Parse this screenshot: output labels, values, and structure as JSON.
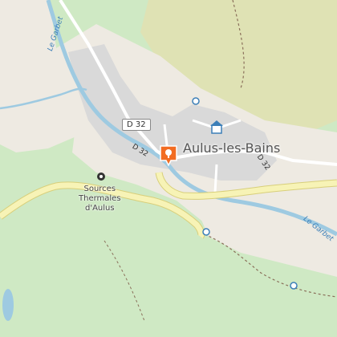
{
  "map": {
    "town_name": "Aulus-les-Bains",
    "poi_label_line1": "Sources",
    "poi_label_line2": "Thermales",
    "poi_label_line3": "d'Aulus",
    "river_label_left": "Le Garbet",
    "river_label_right": "Le Garbet",
    "road_shield": "D 32",
    "road_label_left": "D 32",
    "road_label_right": "D 32"
  },
  "colors": {
    "forest": "#cfe9c4",
    "meadow": "#eeeae2",
    "heath": "#dfe2b4",
    "urban": "#d9d9d9",
    "water": "#9ecae1",
    "main_road": "#f7f3b6",
    "main_road_casing": "#d8cf7a",
    "marker": "#f26c22"
  },
  "icons": [
    "location-marker-icon",
    "town-hall-icon",
    "spring-icon",
    "viewpoint-icon"
  ]
}
